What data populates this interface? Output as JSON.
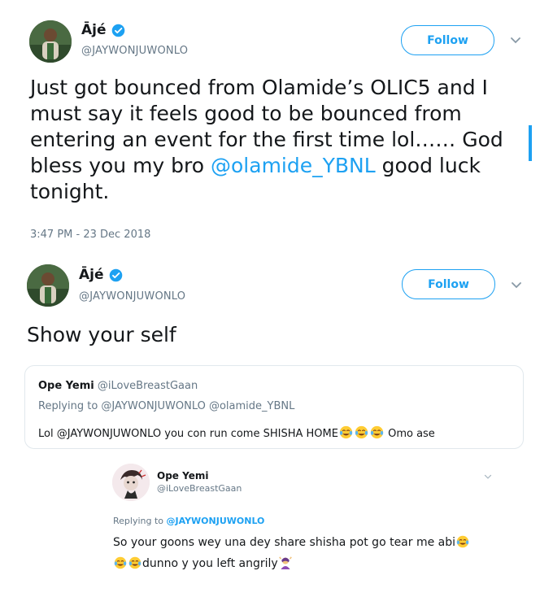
{
  "tweet1": {
    "display_name": "Ājé",
    "handle": "@JAYWONJUWONLO",
    "follow_label": "Follow",
    "text_parts": {
      "line_a": "Just got bounced from Olamide’s OLIC5 and I",
      "line_b": "must say it feels good to be bounced from",
      "line_c": "entering an event for the first time lol……  God",
      "line_d_pre": "bless you my bro ",
      "mention": "@olamide_YBNL",
      "line_d_post": " good luck",
      "line_e": "tonight."
    },
    "timestamp": "3:47 PM - 23 Dec 2018"
  },
  "tweet2": {
    "display_name": "Ājé",
    "handle": "@JAYWONJUWONLO",
    "follow_label": "Follow",
    "text": "Show your self"
  },
  "quoted_tweet": {
    "name": "Ope Yemi",
    "handle": "@iLoveBreastGaan",
    "replying_to": "Replying to @JAYWONJUWONLO @olamide_YBNL",
    "text_pre": "Lol @JAYWONJUWONLO you con run come SHISHA HOME",
    "text_post": " Omo ase",
    "emoji": "tears-of-joy-emoji"
  },
  "reply_screenshot": {
    "name": "Ope Yemi",
    "handle": "@iLoveBreastGaan",
    "replying_label": "Replying to ",
    "replying_handle": "@JAYWONJUWONLO",
    "line1": "So your goons wey una dey share shisha pot go tear me abi",
    "line2": "dunno y you left angrily",
    "emoji_end": "woman-gesturing-emoji"
  },
  "colors": {
    "accent": "#1da1f2",
    "text": "#14171a",
    "muted": "#657786",
    "border": "#e1e8ed"
  },
  "icons": [
    "verified-badge-icon",
    "chevron-down-icon",
    "tears-of-joy-emoji",
    "woman-gesturing-emoji"
  ]
}
